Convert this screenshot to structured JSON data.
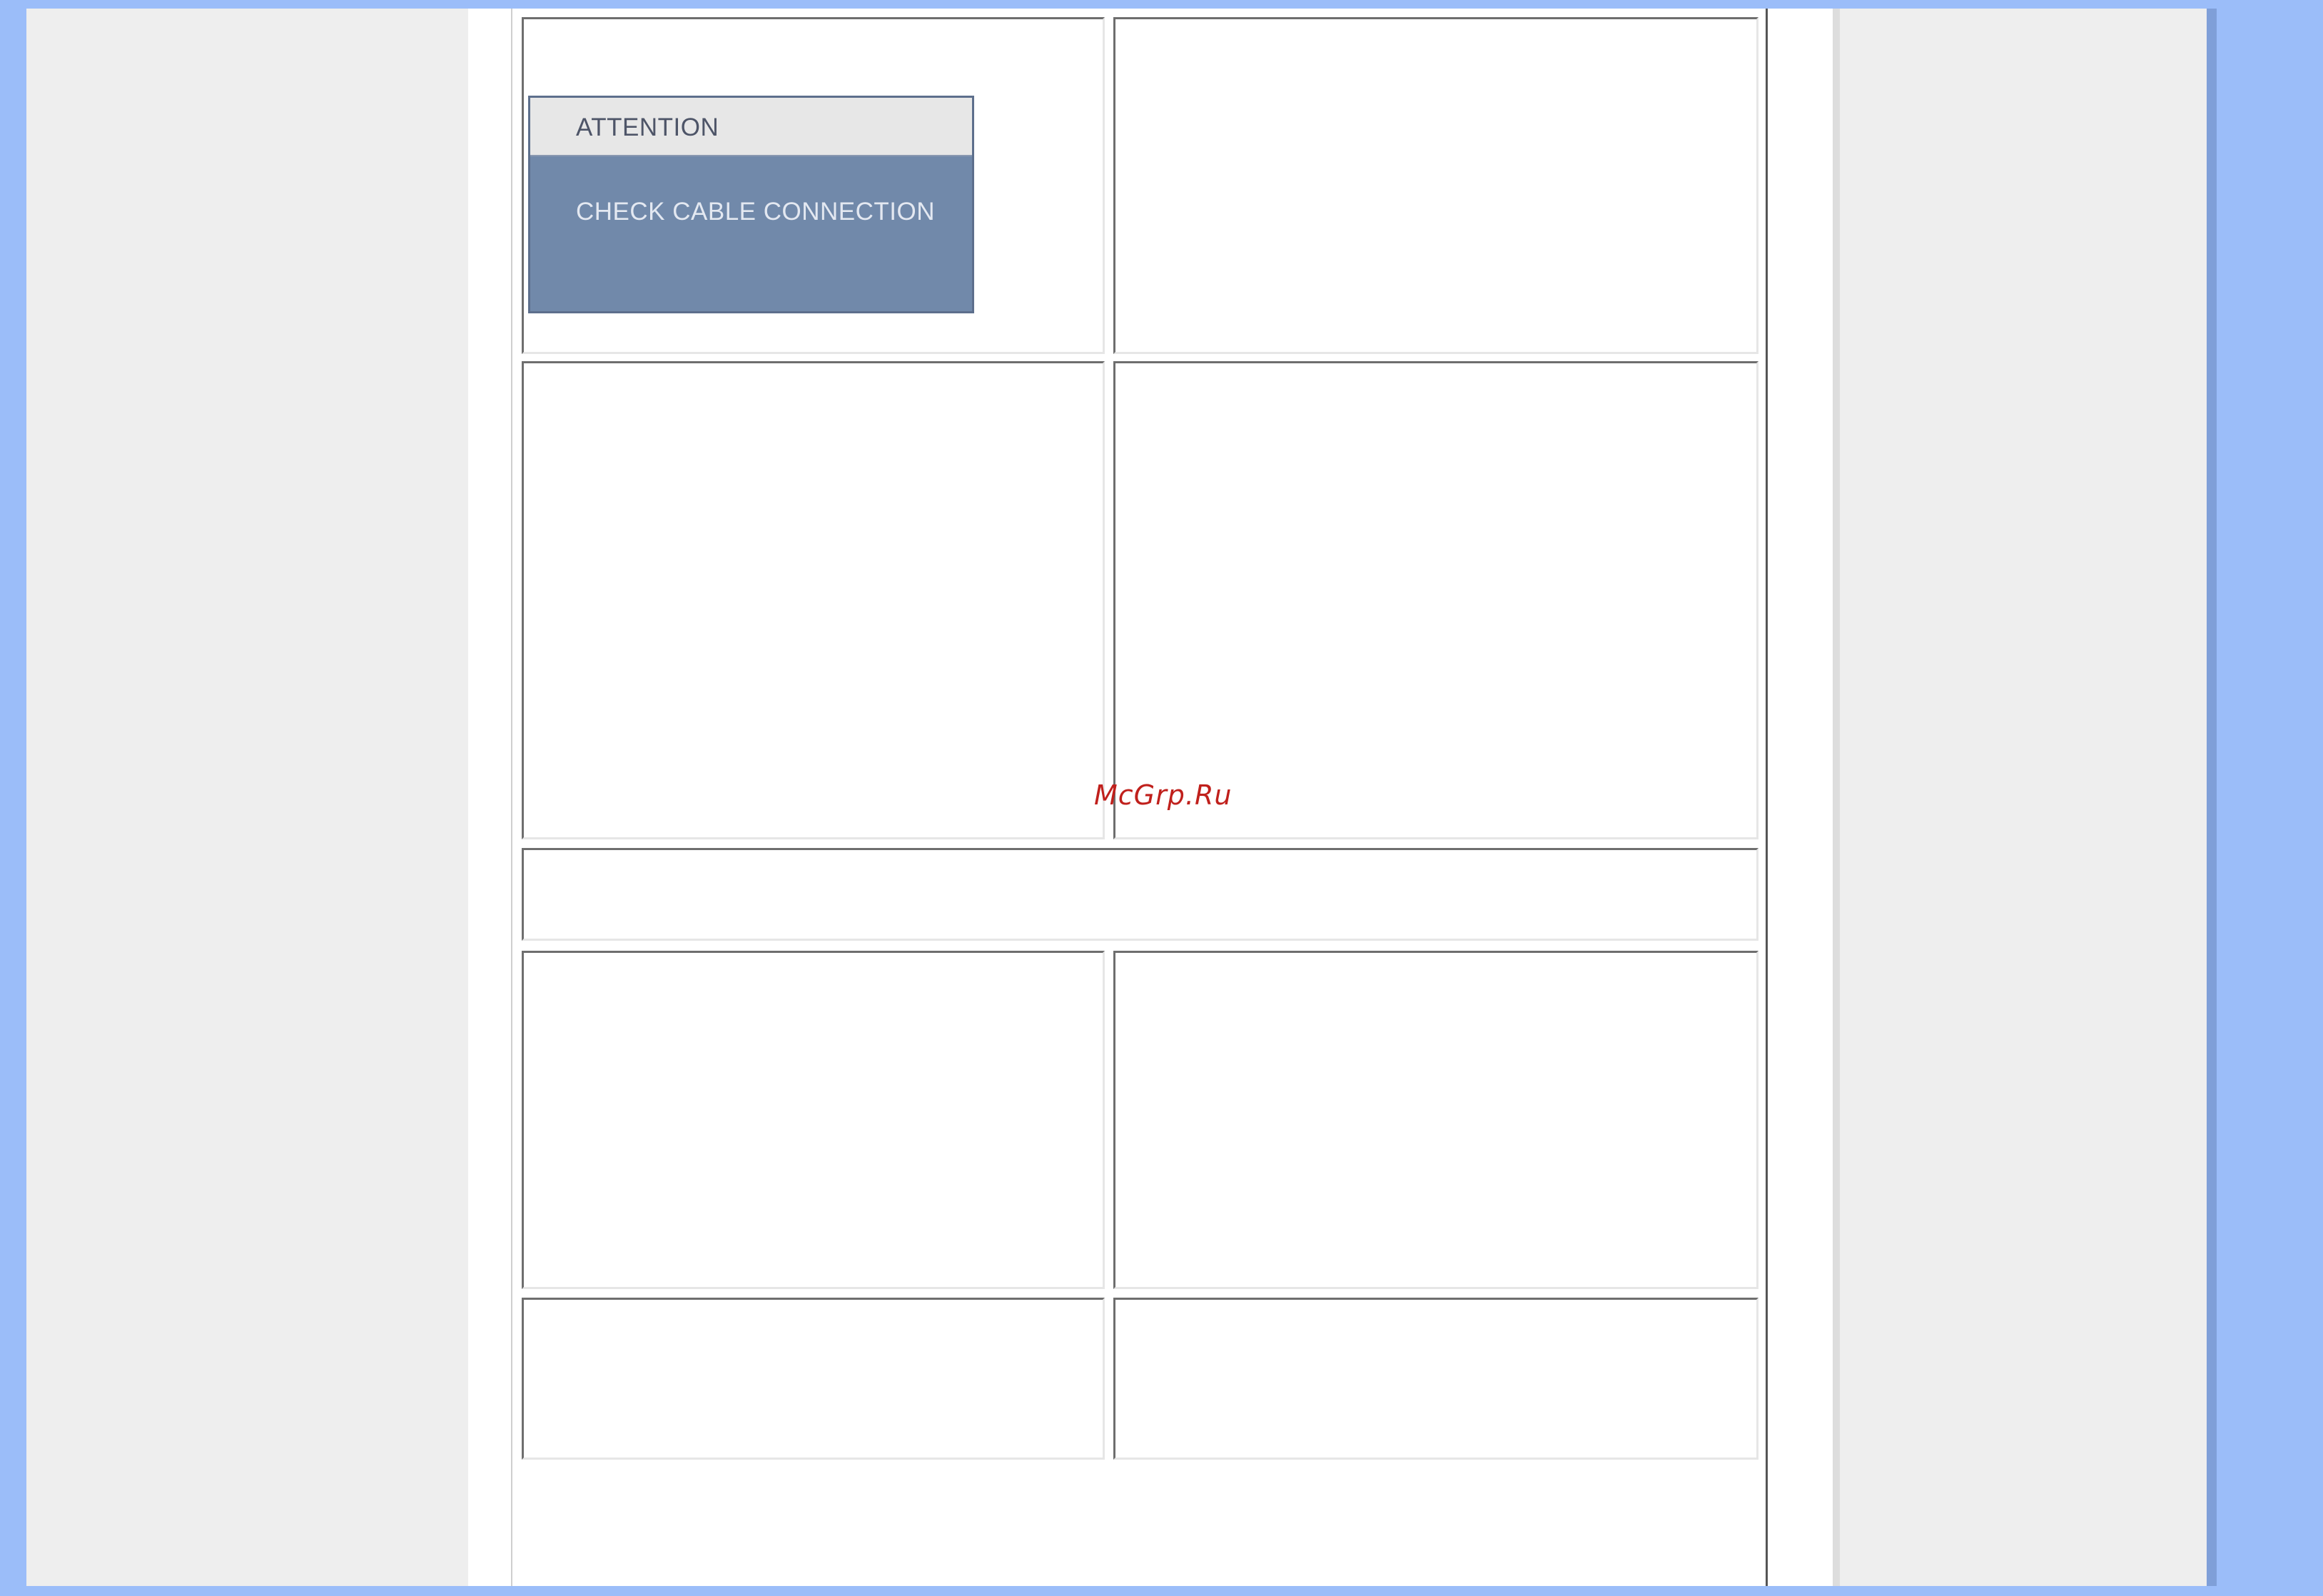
{
  "osd": {
    "title": "ATTENTION",
    "message": "CHECK CABLE CONNECTION"
  },
  "watermark": {
    "text": "McGrp.Ru"
  },
  "colors": {
    "background_blue": "#9bbdf9",
    "page_gray": "#eeeeee",
    "osd_header": "#e7e7e7",
    "osd_body": "#7189aa",
    "watermark_red": "#c0201c"
  }
}
